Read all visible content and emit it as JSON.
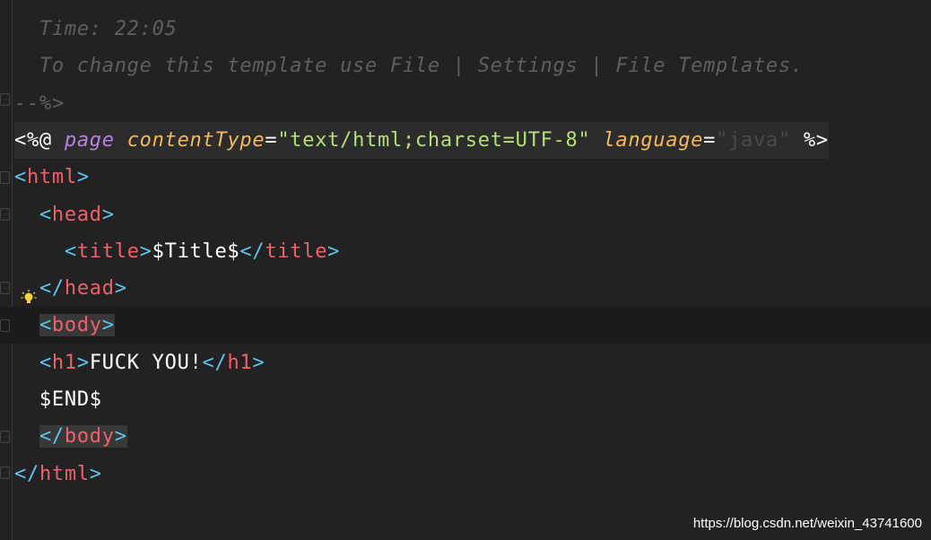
{
  "editor": {
    "lines": [
      [
        {
          "t": "  Time: 22:05",
          "c": "comment"
        }
      ],
      [
        {
          "t": "  To change this template use File | Settings | File Templates.",
          "c": "comment"
        }
      ],
      [
        {
          "t": "--%>",
          "c": "comment"
        }
      ],
      [
        {
          "t": "<%@ ",
          "c": "plain"
        },
        {
          "t": "page",
          "c": "kw"
        },
        {
          "t": " ",
          "c": "plain"
        },
        {
          "t": "contentType",
          "c": "attr"
        },
        {
          "t": "=",
          "c": "plain"
        },
        {
          "t": "\"text/html;charset=UTF-8\"",
          "c": "str"
        },
        {
          "t": " ",
          "c": "plain"
        },
        {
          "t": "language",
          "c": "attr"
        },
        {
          "t": "=",
          "c": "plain"
        },
        {
          "t": "\"java\"",
          "c": "dim"
        },
        {
          "t": " %>",
          "c": "plain"
        }
      ],
      [
        {
          "t": "<",
          "c": "bracket"
        },
        {
          "t": "html",
          "c": "tag"
        },
        {
          "t": ">",
          "c": "bracket"
        }
      ],
      [
        {
          "t": "  ",
          "c": "plain"
        },
        {
          "t": "<",
          "c": "bracket"
        },
        {
          "t": "head",
          "c": "tag"
        },
        {
          "t": ">",
          "c": "bracket"
        }
      ],
      [
        {
          "t": "    ",
          "c": "plain"
        },
        {
          "t": "<",
          "c": "bracket"
        },
        {
          "t": "title",
          "c": "tag"
        },
        {
          "t": ">",
          "c": "bracket"
        },
        {
          "t": "$Title$",
          "c": "plain"
        },
        {
          "t": "</",
          "c": "bracket"
        },
        {
          "t": "title",
          "c": "tag"
        },
        {
          "t": ">",
          "c": "bracket"
        }
      ],
      [
        {
          "t": "  ",
          "c": "plain"
        },
        {
          "t": "</",
          "c": "bracket"
        },
        {
          "t": "head",
          "c": "tag"
        },
        {
          "t": ">",
          "c": "bracket"
        }
      ],
      [
        {
          "t": "  ",
          "c": "plain"
        },
        {
          "t": "<",
          "c": "bracket m"
        },
        {
          "t": "body",
          "c": "tag m"
        },
        {
          "t": ">",
          "c": "bracket m"
        }
      ],
      [
        {
          "t": "  ",
          "c": "plain"
        },
        {
          "t": "<",
          "c": "bracket"
        },
        {
          "t": "h1",
          "c": "tag"
        },
        {
          "t": ">",
          "c": "bracket"
        },
        {
          "t": "FUCK YOU!",
          "c": "plain"
        },
        {
          "t": "</",
          "c": "bracket"
        },
        {
          "t": "h1",
          "c": "tag"
        },
        {
          "t": ">",
          "c": "bracket"
        }
      ],
      [
        {
          "t": "  $END$",
          "c": "plain"
        }
      ],
      [
        {
          "t": "  ",
          "c": "plain"
        },
        {
          "t": "</",
          "c": "bracket m"
        },
        {
          "t": "body",
          "c": "tag m"
        },
        {
          "t": ">",
          "c": "bracket m"
        }
      ],
      [
        {
          "t": "</",
          "c": "bracket"
        },
        {
          "t": "html",
          "c": "tag"
        },
        {
          "t": ">",
          "c": "bracket"
        }
      ]
    ],
    "current_line": 8,
    "highlighted_line": 3
  },
  "watermark": "https://blog.csdn.net/weixin_43741600"
}
